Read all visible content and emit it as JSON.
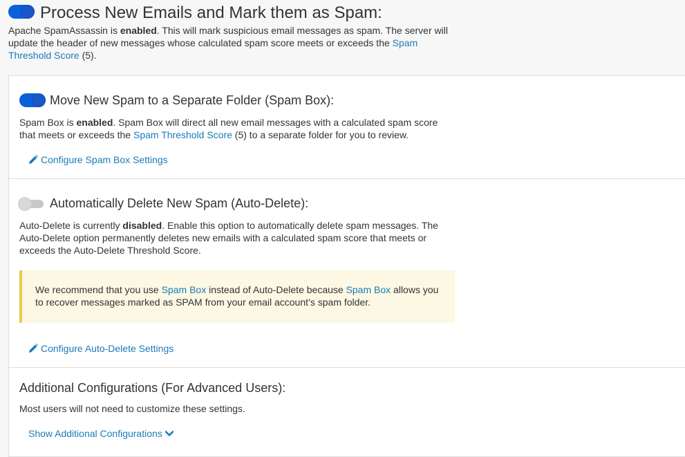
{
  "main": {
    "title": "Process New Emails and Mark them as Spam:",
    "desc_pre": "Apache SpamAssassin is ",
    "desc_bold": "enabled",
    "desc_mid": ". This will mark suspicious email messages as spam. The server will update the header of new messages whose calculated spam score meets or exceeds the ",
    "desc_link": "Spam Threshold Score",
    "desc_post": " (5).",
    "toggle_state": "on"
  },
  "spambox": {
    "title": "Move New Spam to a Separate Folder (Spam Box):",
    "desc_pre": "Spam Box is ",
    "desc_bold": "enabled",
    "desc_mid": ". Spam Box will direct all new email messages with a calculated spam score that meets or exceeds the ",
    "desc_link": "Spam Threshold Score",
    "desc_post": " (5) to a separate folder for you to review.",
    "configure_label": "Configure Spam Box Settings",
    "toggle_state": "on"
  },
  "autodelete": {
    "title": "Automatically Delete New Spam (Auto-Delete):",
    "desc_pre": "Auto-Delete is currently ",
    "desc_bold": "disabled",
    "desc_post": ". Enable this option to automatically delete spam messages. The Auto-Delete option permanently deletes new emails with a calculated spam score that meets or exceeds the Auto-Delete Threshold Score.",
    "note_pre": "We recommend that you use ",
    "note_link1": "Spam Box",
    "note_mid": " instead of Auto-Delete because ",
    "note_link2": "Spam Box",
    "note_post": " allows you to recover messages marked as SPAM from your email account’s spam folder.",
    "configure_label": "Configure Auto-Delete Settings",
    "toggle_state": "off"
  },
  "additional": {
    "title": "Additional Configurations (For Advanced Users):",
    "desc": "Most users will not need to customize these settings.",
    "show_label": "Show Additional Configurations"
  },
  "colors": {
    "accent": "#1a7bb9",
    "toggle_on": "#0a61d9",
    "note_bg": "#fcf8e3",
    "note_border": "#f0c94a"
  }
}
